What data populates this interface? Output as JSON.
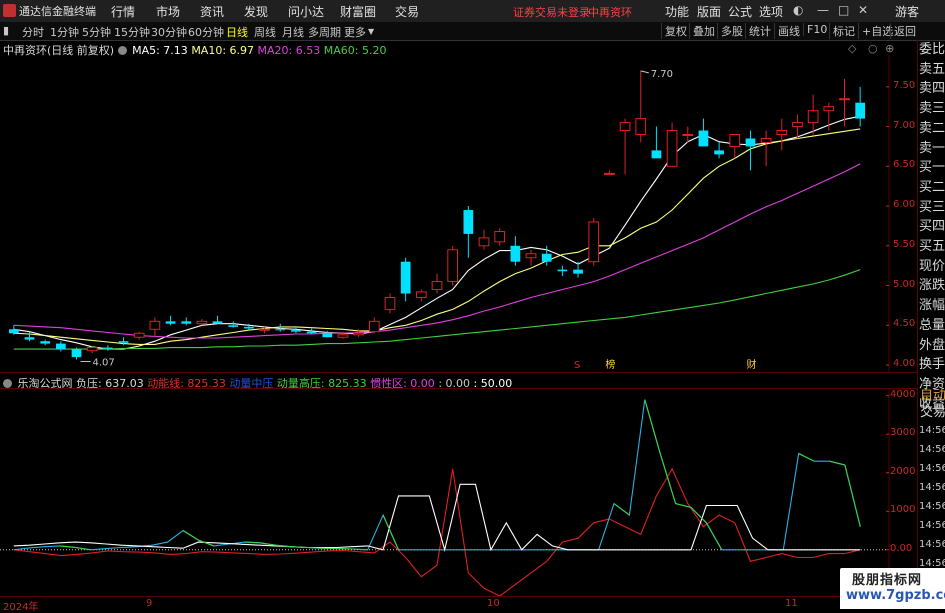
{
  "titlebar": {
    "app_name": "通达信金融终端",
    "menus": [
      "行情",
      "市场",
      "资讯",
      "发现",
      "问小达",
      "财富圈",
      "交易"
    ],
    "notice": "证券交易未登录",
    "stock_name": "中再资环",
    "right_menus": [
      "功能",
      "版面",
      "公式",
      "选项"
    ],
    "guest": "游客"
  },
  "toolbar": {
    "periods": [
      "分时",
      "1分钟",
      "5分钟",
      "15分钟",
      "30分钟",
      "60分钟",
      "日线",
      "周线",
      "月线",
      "多周期",
      "更多"
    ],
    "active_period": "日线",
    "right_buttons": [
      "复权",
      "叠加",
      "多股",
      "统计",
      "画线",
      "F10",
      "标记",
      "+自选",
      "返回"
    ]
  },
  "main_header": {
    "title": "中再资环(日线 前复权)",
    "ma5": "MA5: 7.13",
    "ma10": "MA10: 6.97",
    "ma20": "MA20: 6.53",
    "ma60": "MA60: 5.20"
  },
  "sub_header": {
    "title": "乐淘公式网 负压:",
    "fuya": "637.03",
    "dongneng": "动能线: 825.33",
    "dongli": "动量中压",
    "donglianggaoya": "动量高压: 825.33",
    "guanxing": "惯性区: 0.00",
    "v1": ": 0.00",
    "v2": ": 50.00"
  },
  "colors": {
    "up": "#e02020",
    "down": "#00e0ff",
    "ma5": "#ffffff",
    "ma10": "#ffff80",
    "ma20": "#e040e0",
    "ma60": "#40d040",
    "grid": "#5a0000"
  },
  "price_axis": [
    "7.50",
    "7.00",
    "6.50",
    "6.00",
    "5.50",
    "5.00",
    "4.50",
    "4.00"
  ],
  "annotations": {
    "high": "7.70",
    "low": "4.07"
  },
  "event_markers": [
    "S",
    "榜",
    "财"
  ],
  "right_panel": [
    "委比",
    "卖五",
    "卖四",
    "卖三",
    "卖二",
    "卖一",
    "买一",
    "买二",
    "买三",
    "买四",
    "买五",
    "现价",
    "涨跌",
    "涨幅",
    "总量",
    "外盘",
    "换手",
    "净资",
    "收益"
  ],
  "right_panel_2": [
    "自动",
    "交易"
  ],
  "sub_axis": [
    "4000",
    "3000",
    "2000",
    "1000",
    "0.00"
  ],
  "sub_times": [
    "14:56",
    "14:56",
    "14:56",
    "14:56",
    "14:56",
    "14:56",
    "14:56",
    "14:56"
  ],
  "x_axis": {
    "year": "2024年",
    "months": [
      "9",
      "10",
      "11"
    ]
  },
  "watermark": {
    "line1": "股朋指标网",
    "line2": "www.7gpzb.com"
  },
  "chart_data": [
    {
      "type": "candlestick",
      "title": "中再资环(日线 前复权)",
      "y_range": [
        3.9,
        7.9
      ],
      "series": [
        {
          "name": "candles",
          "ohlc": [
            [
              4.45,
              4.5,
              4.38,
              4.4
            ],
            [
              4.35,
              4.42,
              4.3,
              4.32
            ],
            [
              4.3,
              4.32,
              4.25,
              4.27
            ],
            [
              4.27,
              4.3,
              4.17,
              4.2
            ],
            [
              4.2,
              4.22,
              4.07,
              4.1
            ],
            [
              4.18,
              4.24,
              4.15,
              4.22
            ],
            [
              4.22,
              4.25,
              4.18,
              4.21
            ],
            [
              4.3,
              4.35,
              4.25,
              4.28
            ],
            [
              4.35,
              4.42,
              4.32,
              4.4
            ],
            [
              4.45,
              4.6,
              4.35,
              4.55
            ],
            [
              4.55,
              4.62,
              4.5,
              4.52
            ],
            [
              4.55,
              4.6,
              4.5,
              4.52
            ],
            [
              4.52,
              4.58,
              4.5,
              4.55
            ],
            [
              4.55,
              4.62,
              4.52,
              4.52
            ],
            [
              4.5,
              4.55,
              4.47,
              4.48
            ],
            [
              4.48,
              4.52,
              4.44,
              4.46
            ],
            [
              4.45,
              4.48,
              4.4,
              4.45
            ],
            [
              4.45,
              4.52,
              4.42,
              4.44
            ],
            [
              4.44,
              4.48,
              4.4,
              4.42
            ],
            [
              4.42,
              4.46,
              4.39,
              4.4
            ],
            [
              4.4,
              4.43,
              4.35,
              4.35
            ],
            [
              4.35,
              4.42,
              4.33,
              4.38
            ],
            [
              4.38,
              4.45,
              4.35,
              4.4
            ],
            [
              4.42,
              4.6,
              4.4,
              4.55
            ],
            [
              4.7,
              4.9,
              4.65,
              4.85
            ],
            [
              5.3,
              5.35,
              4.8,
              4.9
            ],
            [
              4.85,
              4.95,
              4.8,
              4.92
            ],
            [
              4.95,
              5.15,
              4.9,
              5.05
            ],
            [
              5.05,
              5.5,
              5.0,
              5.45
            ],
            [
              5.95,
              6.0,
              5.35,
              5.65
            ],
            [
              5.5,
              5.7,
              5.45,
              5.6
            ],
            [
              5.55,
              5.72,
              5.5,
              5.68
            ],
            [
              5.5,
              5.62,
              5.25,
              5.3
            ],
            [
              5.35,
              5.45,
              5.25,
              5.4
            ],
            [
              5.4,
              5.5,
              5.25,
              5.3
            ],
            [
              5.2,
              5.25,
              5.12,
              5.18
            ],
            [
              5.2,
              5.3,
              5.1,
              5.15
            ],
            [
              5.3,
              5.85,
              5.25,
              5.8
            ],
            [
              6.4,
              6.45,
              6.4,
              6.41
            ],
            [
              6.95,
              7.1,
              6.4,
              7.05
            ],
            [
              6.9,
              7.7,
              6.8,
              7.1
            ],
            [
              6.7,
              7.0,
              6.6,
              6.6
            ],
            [
              6.5,
              7.05,
              6.5,
              6.95
            ],
            [
              6.9,
              7.0,
              6.8,
              6.9
            ],
            [
              6.95,
              7.1,
              6.75,
              6.75
            ],
            [
              6.7,
              6.8,
              6.6,
              6.65
            ],
            [
              6.75,
              6.9,
              6.6,
              6.9
            ],
            [
              6.85,
              6.95,
              6.45,
              6.75
            ],
            [
              6.8,
              6.95,
              6.5,
              6.85
            ],
            [
              6.9,
              7.1,
              6.7,
              6.95
            ],
            [
              7.0,
              7.15,
              6.85,
              7.05
            ],
            [
              7.05,
              7.4,
              6.9,
              7.2
            ],
            [
              7.2,
              7.3,
              6.95,
              7.25
            ],
            [
              7.35,
              7.6,
              7.0,
              7.35
            ],
            [
              7.3,
              7.5,
              7.0,
              7.1
            ]
          ]
        },
        {
          "name": "MA5",
          "values": [
            4.45,
            4.42,
            4.37,
            4.32,
            4.28,
            4.23,
            4.2,
            4.2,
            4.24,
            4.3,
            4.38,
            4.44,
            4.5,
            4.52,
            4.52,
            4.5,
            4.48,
            4.46,
            4.45,
            4.43,
            4.41,
            4.4,
            4.39,
            4.42,
            4.51,
            4.6,
            4.72,
            4.84,
            4.95,
            5.19,
            5.33,
            5.44,
            5.44,
            5.48,
            5.45,
            5.37,
            5.27,
            5.37,
            5.47,
            5.76,
            6.06,
            6.34,
            6.63,
            6.81,
            6.9,
            6.81,
            6.78,
            6.77,
            6.79,
            6.82,
            6.87,
            6.94,
            7.02,
            7.09,
            7.13
          ]
        },
        {
          "name": "MA10",
          "values": [
            4.4,
            4.39,
            4.37,
            4.35,
            4.33,
            4.31,
            4.29,
            4.27,
            4.26,
            4.26,
            4.3,
            4.32,
            4.35,
            4.38,
            4.41,
            4.44,
            4.46,
            4.48,
            4.48,
            4.47,
            4.46,
            4.45,
            4.43,
            4.43,
            4.47,
            4.5,
            4.56,
            4.64,
            4.7,
            4.8,
            4.93,
            5.05,
            5.15,
            5.22,
            5.31,
            5.39,
            5.42,
            5.5,
            5.5,
            5.6,
            5.72,
            5.8,
            5.95,
            6.15,
            6.35,
            6.5,
            6.6,
            6.72,
            6.78,
            6.82,
            6.85,
            6.88,
            6.91,
            6.94,
            6.97
          ]
        },
        {
          "name": "MA20",
          "values": [
            4.5,
            4.49,
            4.48,
            4.47,
            4.45,
            4.43,
            4.41,
            4.39,
            4.37,
            4.36,
            4.35,
            4.34,
            4.34,
            4.34,
            4.35,
            4.36,
            4.37,
            4.38,
            4.39,
            4.39,
            4.4,
            4.4,
            4.41,
            4.42,
            4.44,
            4.47,
            4.5,
            4.53,
            4.57,
            4.62,
            4.68,
            4.73,
            4.79,
            4.85,
            4.9,
            4.95,
            5.0,
            5.05,
            5.12,
            5.2,
            5.28,
            5.36,
            5.44,
            5.52,
            5.6,
            5.7,
            5.8,
            5.9,
            5.99,
            6.07,
            6.16,
            6.25,
            6.34,
            6.43,
            6.53
          ]
        },
        {
          "name": "MA60",
          "values": [
            4.2,
            4.2,
            4.2,
            4.2,
            4.2,
            4.2,
            4.2,
            4.21,
            4.21,
            4.21,
            4.22,
            4.22,
            4.22,
            4.23,
            4.23,
            4.24,
            4.24,
            4.25,
            4.25,
            4.26,
            4.27,
            4.27,
            4.28,
            4.29,
            4.3,
            4.32,
            4.34,
            4.36,
            4.38,
            4.4,
            4.42,
            4.44,
            4.46,
            4.48,
            4.5,
            4.52,
            4.54,
            4.56,
            4.58,
            4.6,
            4.63,
            4.66,
            4.69,
            4.72,
            4.75,
            4.78,
            4.82,
            4.86,
            4.9,
            4.94,
            4.98,
            5.02,
            5.07,
            5.13,
            5.2
          ]
        }
      ]
    },
    {
      "type": "line",
      "title": "乐淘公式网",
      "y_range": [
        -1200,
        4200
      ],
      "series": [
        {
          "name": "负压",
          "values": [
            0,
            -50,
            -100,
            -150,
            -120,
            -80,
            -30,
            -50,
            -60,
            -80,
            -120,
            -100,
            -50,
            -60,
            -80,
            -100,
            -120,
            -110,
            -90,
            -60,
            -30,
            -20,
            -50,
            -80,
            200,
            -200,
            -700,
            -400,
            2100,
            -600,
            -1000,
            -1200,
            -900,
            -600,
            -300,
            200,
            300,
            700,
            800,
            600,
            400,
            1400,
            2100,
            1200,
            600,
            900,
            700,
            -300,
            -200,
            -100,
            -200,
            -200,
            -100,
            -100,
            0
          ]
        },
        {
          "name": "动能线",
          "values": [
            0,
            50,
            80,
            100,
            60,
            0,
            30,
            60,
            80,
            120,
            200,
            500,
            250,
            100,
            150,
            200,
            180,
            120,
            80,
            60,
            40,
            30,
            20,
            0,
            900,
            0,
            0,
            0,
            0,
            0,
            0,
            0,
            0,
            0,
            0,
            0,
            0,
            0,
            0,
            1200,
            900,
            3900,
            2500,
            1200,
            1100,
            700,
            0,
            0,
            0,
            0,
            0,
            2500,
            2300,
            2300,
            2200,
            600
          ]
        },
        {
          "name": "动量高压",
          "values": [
            100,
            120,
            150,
            180,
            200,
            180,
            150,
            120,
            100,
            80,
            60,
            40,
            200,
            180,
            160,
            140,
            120,
            100,
            80,
            60,
            60,
            60,
            80,
            100,
            0,
            1400,
            1400,
            1400,
            0,
            1700,
            1700,
            0,
            700,
            0,
            400,
            100,
            0,
            0,
            0,
            0,
            0,
            0,
            0,
            0,
            0,
            1150,
            1150,
            1150,
            300,
            0,
            0,
            0,
            0,
            0,
            0,
            0
          ]
        }
      ]
    }
  ]
}
